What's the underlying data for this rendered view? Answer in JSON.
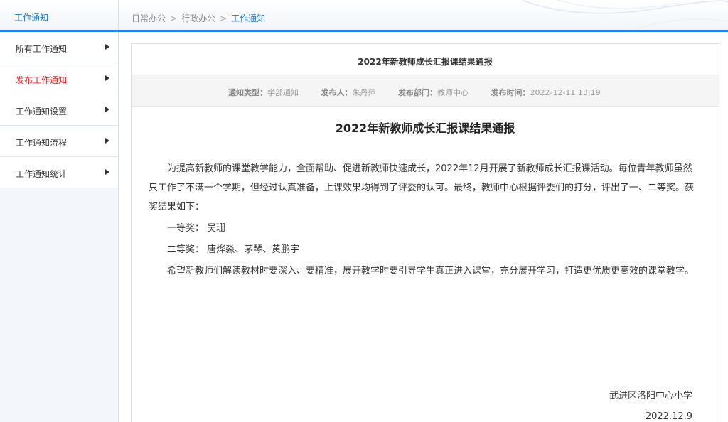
{
  "sidebar": {
    "title": "工作通知",
    "items": [
      {
        "label": "所有工作通知"
      },
      {
        "label": "发布工作通知"
      },
      {
        "label": "工作通知设置"
      },
      {
        "label": "工作通知流程"
      },
      {
        "label": "工作通知统计"
      }
    ]
  },
  "breadcrumb": {
    "items": [
      "日常办公",
      "行政办公",
      "工作通知"
    ],
    "separator": ">"
  },
  "notice": {
    "header_title": "2022年新教师成长汇报课结果通报",
    "meta": {
      "type_label": "通知类型：",
      "type_value": "学部通知",
      "publisher_label": "发布人：",
      "publisher_value": "朱丹萍",
      "dept_label": "发布部门：",
      "dept_value": "教师中心",
      "time_label": "发布时间：",
      "time_value": "2022-12-11 13:19"
    },
    "article_title": "2022年新教师成长汇报课结果通报",
    "paragraphs": [
      "为提高新教师的课堂教学能力，全面帮助、促进新教师快速成长，2022年12月开展了新教师成长汇报课活动。每位青年教师虽然只工作了不满一个学期，但经过认真准备，上课效果均得到了评委的认可。最终，教师中心根据评委们的打分，评出了一、二等奖。获奖结果如下：",
      "一等奖：  吴珊",
      "二等奖：  唐烨淼、茅琴、黄鹏宇",
      "希望新教师们解读教材时要深入、要精准，展开教学时要引导学生真正进入课堂，充分展开学习，打造更优质更高效的课堂教学。"
    ],
    "signature_org": "武进区洛阳中心小学",
    "signature_date": "2022.12.9"
  },
  "colors": {
    "accent": "#1e88e5",
    "active_menu": "#e02020"
  }
}
